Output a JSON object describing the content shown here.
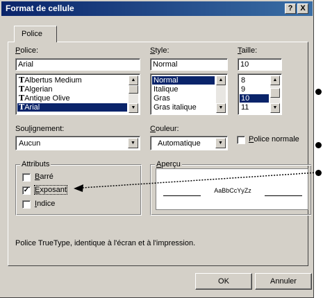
{
  "window": {
    "title": "Format de cellule",
    "help_glyph": "?",
    "close_glyph": "X"
  },
  "tab": {
    "label": "Police"
  },
  "font": {
    "label_accel": "P",
    "label_rest": "olice:",
    "value": "Arial",
    "items": [
      {
        "name": "Albertus Medium",
        "tt": "T"
      },
      {
        "name": "Algerian",
        "tt": "T"
      },
      {
        "name": "Antique Olive",
        "tt": "T"
      },
      {
        "name": "Arial",
        "tt": "T",
        "selected": true
      }
    ]
  },
  "style": {
    "label_accel": "S",
    "label_rest": "tyle:",
    "value": "Normal",
    "items": [
      "Normal",
      "Italique",
      "Gras",
      "Gras italique"
    ]
  },
  "size": {
    "label_accel": "T",
    "label_rest": "aille:",
    "value": "10",
    "items": [
      "8",
      "9",
      "10",
      "11"
    ]
  },
  "underline": {
    "label_pre": "Sou",
    "label_accel": "l",
    "label_post": "ignement:",
    "value": "Aucun"
  },
  "color": {
    "label_accel": "C",
    "label_rest": "ouleur:",
    "value": "Automatique"
  },
  "normal_font": {
    "label_accel": "P",
    "label_mid": "o",
    "label_rest": "lice normale",
    "checked": false
  },
  "effects": {
    "title": "Attributs",
    "items": [
      {
        "accel": "B",
        "rest": "arré",
        "checked": false
      },
      {
        "accel": "E",
        "rest": "xposant",
        "checked": true
      },
      {
        "accel": "I",
        "rest": "ndice",
        "checked": false
      }
    ]
  },
  "preview": {
    "title_accel": "A",
    "title_rest": "perçu",
    "sample": "AaBbCcYyZz"
  },
  "description": "Police TrueType, identique à l'écran et à l'impression.",
  "buttons": {
    "ok": "OK",
    "cancel": "Annuler"
  },
  "glyphs": {
    "check": "✓",
    "up": "▲",
    "down": "▼"
  }
}
